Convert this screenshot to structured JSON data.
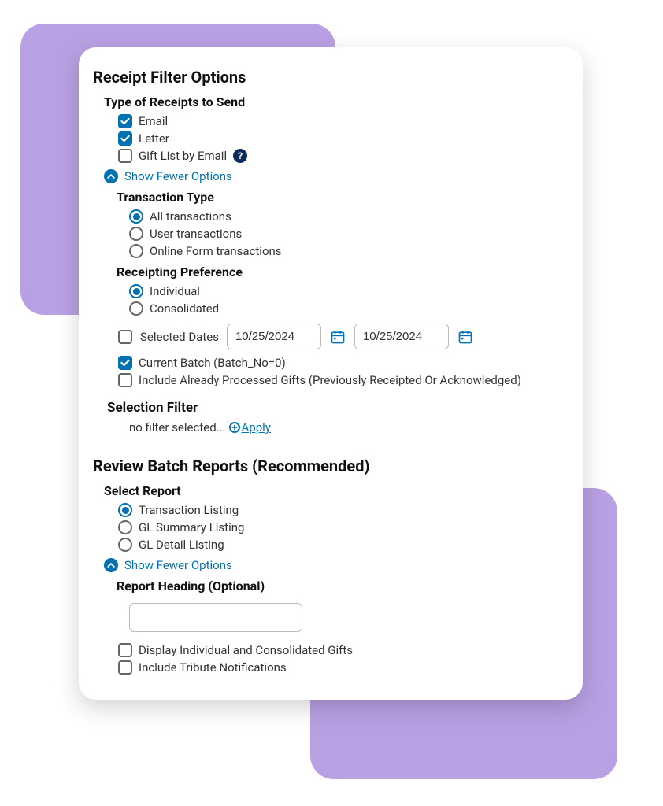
{
  "receiptFilter": {
    "title": "Receipt Filter Options",
    "typeOfReceipts": {
      "heading": "Type of Receipts to Send",
      "email": "Email",
      "letter": "Letter",
      "giftList": "Gift List by Email"
    },
    "showFewer": "Show Fewer Options",
    "transactionType": {
      "heading": "Transaction Type",
      "all": "All transactions",
      "user": "User transactions",
      "online": "Online Form transactions"
    },
    "receiptingPref": {
      "heading": "Receipting Preference",
      "individual": "Individual",
      "consolidated": "Consolidated"
    },
    "selectedDates": {
      "label": "Selected Dates",
      "from": "10/25/2024",
      "to": "10/25/2024"
    },
    "currentBatch": "Current Batch (Batch_No=0)",
    "includeProcessed": "Include Already Processed Gifts (Previously Receipted Or Acknowledged)",
    "selectionFilter": {
      "heading": "Selection Filter",
      "text": "no filter selected...",
      "apply": "Apply"
    }
  },
  "reviewBatch": {
    "title": "Review Batch Reports (Recommended)",
    "selectReport": {
      "heading": "Select Report",
      "transaction": "Transaction Listing",
      "glSummary": "GL Summary Listing",
      "glDetail": "GL Detail Listing"
    },
    "showFewer": "Show Fewer Options",
    "reportHeading": {
      "heading": "Report Heading (Optional)",
      "value": ""
    },
    "displayIndCons": "Display Individual and Consolidated Gifts",
    "includeTribute": "Include Tribute Notifications"
  }
}
